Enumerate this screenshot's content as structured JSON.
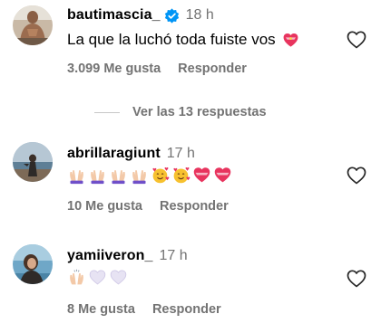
{
  "comments": [
    {
      "username": "bautimascia_",
      "verified": true,
      "time": "18 h",
      "text": "La que la luchó toda fuiste vos",
      "likes": "3.099 Me gusta",
      "reply_label": "Responder"
    },
    {
      "username": "abrillaragiunt",
      "time": "17 h",
      "emojis": [
        "raising-hands-icon",
        "raising-hands-icon",
        "raising-hands-icon",
        "raising-hands-icon",
        "smiling-face-hearts-icon",
        "smiling-face-hearts-icon",
        "heart-with-ribbon-icon",
        "heart-with-ribbon-icon"
      ],
      "likes": "10 Me gusta",
      "reply_label": "Responder"
    },
    {
      "username": "yamiiveron_",
      "time": "17 h",
      "emojis": [
        "raising-hands-icon",
        "white-heart-icon",
        "white-heart-icon"
      ],
      "likes": "8 Me gusta",
      "reply_label": "Responder"
    }
  ],
  "view_replies": "Ver las 13 respuestas",
  "colors": {
    "secondary_text": "#737373",
    "verified_blue": "#0095f6",
    "heart_emoji": "#e8345e"
  }
}
